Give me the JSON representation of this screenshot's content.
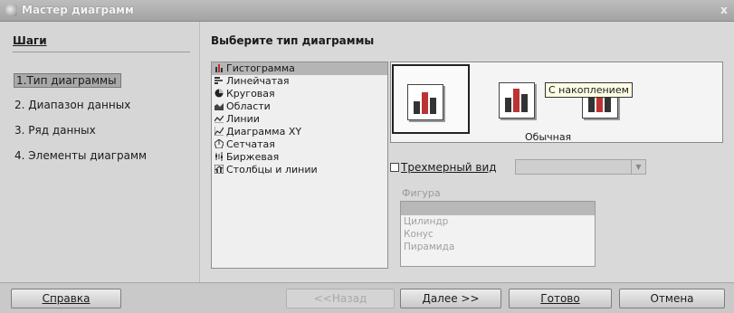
{
  "window": {
    "title": "Мастер диаграмм",
    "close": "x"
  },
  "steps": {
    "heading": "Шаги",
    "items": [
      "1.Тип диаграммы",
      "2. Диапазон данных",
      "3. Ряд данных",
      "4. Элементы диаграмм"
    ]
  },
  "chart_types": {
    "label": "Выберите тип диаграммы",
    "items": [
      {
        "label": "Гистограмма",
        "icon": "column-chart-icon"
      },
      {
        "label": "Линейчатая",
        "icon": "bar-chart-icon"
      },
      {
        "label": "Круговая",
        "icon": "pie-chart-icon"
      },
      {
        "label": "Области",
        "icon": "area-chart-icon"
      },
      {
        "label": "Линии",
        "icon": "line-chart-icon"
      },
      {
        "label": "Диаграмма XY",
        "icon": "xy-chart-icon"
      },
      {
        "label": "Сетчатая",
        "icon": "net-chart-icon"
      },
      {
        "label": "Биржевая",
        "icon": "stock-chart-icon"
      },
      {
        "label": "Столбцы и линии",
        "icon": "column-line-chart-icon"
      }
    ]
  },
  "variants": {
    "caption": "Обычная",
    "tooltip": "С накоплением"
  },
  "three_d": {
    "label": "Трехмерный вид"
  },
  "shape": {
    "label": "Фигура",
    "options": [
      "Цилиндр",
      "Конус",
      "Пирамида"
    ]
  },
  "buttons": {
    "help": "Справка",
    "back": "<<Назад",
    "next": "Далее >>",
    "finish": "Готово",
    "cancel": "Отмена"
  }
}
